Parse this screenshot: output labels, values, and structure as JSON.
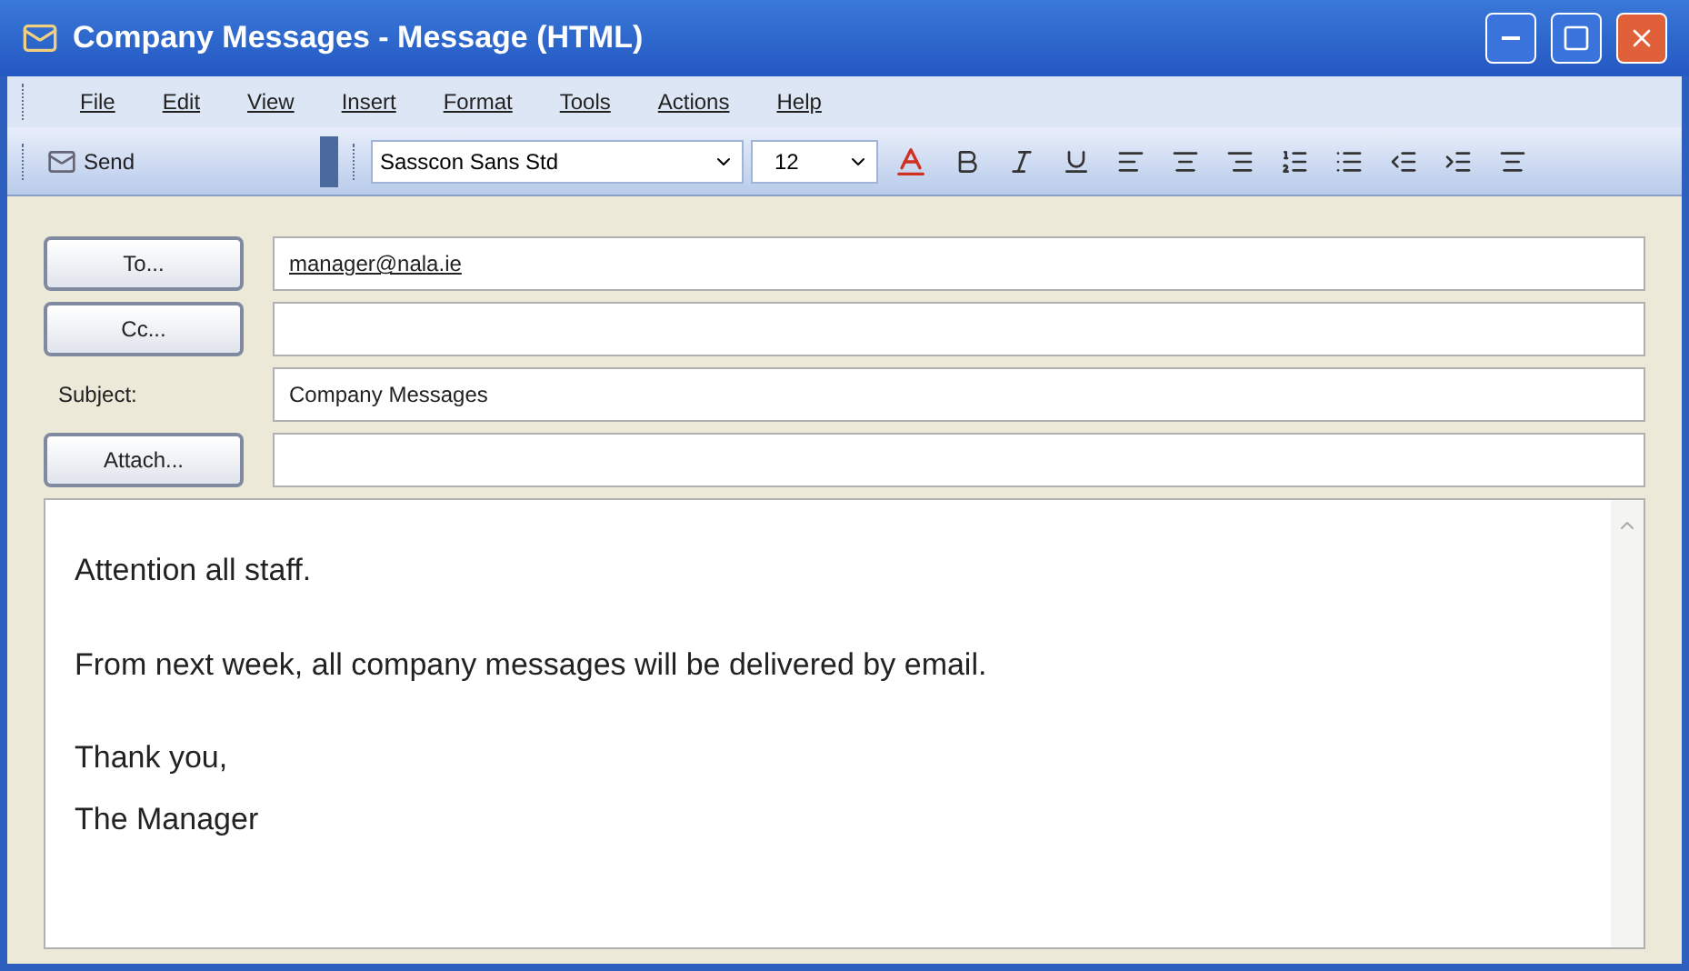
{
  "window": {
    "title": "Company Messages - Message (HTML)"
  },
  "menu": [
    "File",
    "Edit",
    "View",
    "Insert",
    "Format",
    "Tools",
    "Actions",
    "Help"
  ],
  "toolbar": {
    "send": "Send",
    "font": "Sasscon Sans Std",
    "size": "12"
  },
  "fields": [
    {
      "kind": "button",
      "label": "To...",
      "value": "manager@nala.ie"
    },
    {
      "kind": "button",
      "label": "Cc..."
    },
    {
      "kind": "label",
      "label": "Subject:",
      "value": "Company Messages"
    },
    {
      "kind": "button",
      "label": "Attach..."
    }
  ],
  "body": {
    "paragraphs": [
      [
        "Attention all staff."
      ],
      [
        "From next week, all company messages will be delivered by email."
      ],
      [
        "Thank you,",
        "The Manager"
      ]
    ]
  }
}
